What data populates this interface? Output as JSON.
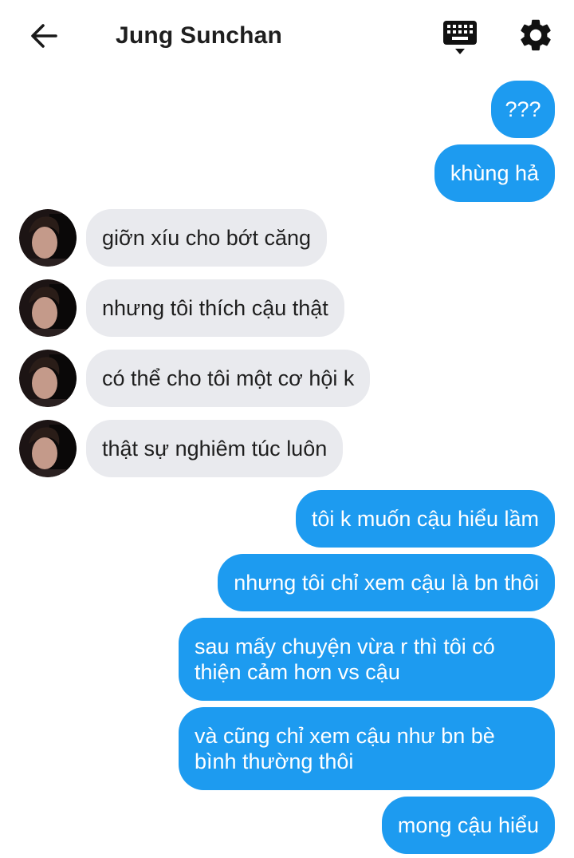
{
  "header": {
    "title": "Jung Sunchan",
    "back_icon": "arrow-left-icon",
    "keyboard_icon": "keyboard-icon",
    "settings_icon": "gear-icon"
  },
  "colors": {
    "outgoing_bubble": "#1d9bf0",
    "incoming_bubble": "#e9eaee",
    "text_dark": "#1f1f1f"
  },
  "messages": [
    {
      "direction": "out",
      "text": "???"
    },
    {
      "direction": "out",
      "text": "khùng hả"
    },
    {
      "direction": "in",
      "text": "giỡn xíu cho bớt căng"
    },
    {
      "direction": "in",
      "text": "nhưng tôi thích cậu thật"
    },
    {
      "direction": "in",
      "text": "có thể cho tôi một cơ hội k"
    },
    {
      "direction": "in",
      "text": "thật sự nghiêm túc luôn"
    },
    {
      "direction": "out",
      "text": "tôi k muốn cậu hiểu lầm"
    },
    {
      "direction": "out",
      "text": "nhưng tôi chỉ xem cậu là bn thôi"
    },
    {
      "direction": "out",
      "text": "sau mấy chuyện vừa r thì tôi có thiện cảm hơn vs cậu"
    },
    {
      "direction": "out",
      "text": "và cũng chỉ xem cậu như bn bè bình thường thôi"
    },
    {
      "direction": "out",
      "text": "mong cậu hiểu"
    }
  ]
}
